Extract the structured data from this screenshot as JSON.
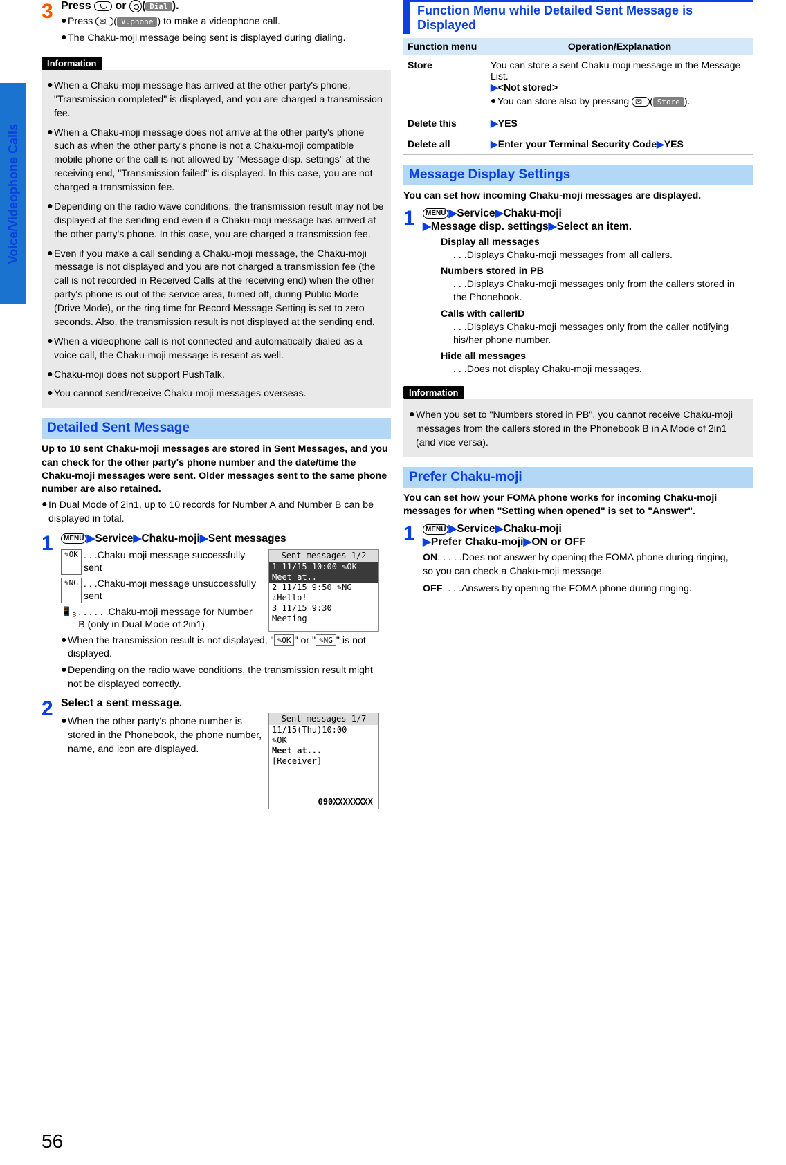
{
  "pageNumber": "56",
  "sideTab": "Voice/Videophone Calls",
  "left": {
    "step3": {
      "num": "3",
      "title_a": "Press ",
      "title_b": " or ",
      "title_c": "(",
      "softkey_dial": "Dial",
      "title_d": ").",
      "b1a": "Press ",
      "b1b": "(",
      "softkey_vphone": "V.phone",
      "b1c": ") to make a videophone call.",
      "b2": "The Chaku-moji message being sent is displayed during dialing."
    },
    "info": {
      "head": "Information",
      "items": [
        "When a Chaku-moji message has arrived at the other party's phone, \"Transmission completed\" is displayed, and you are charged a transmission fee.",
        "When a Chaku-moji message does not arrive at the other party's phone such as when the other party's phone is not a Chaku-moji compatible mobile phone or the call is not allowed by \"Message disp. settings\" at the receiving end, \"Transmission failed\" is displayed. In this case, you are not charged a transmission fee.",
        "Depending on the radio wave conditions, the transmission result may not be displayed at the sending end even if a Chaku-moji message has arrived at the other party's phone. In this case, you are charged a transmission fee.",
        "Even if you make a call sending a Chaku-moji message, the Chaku-moji message is not displayed and you are not charged a transmission fee (the call is not recorded in Received Calls at the receiving end) when the other party's phone is out of the service area, turned off, during Public Mode (Drive Mode), or the ring time for Record Message Setting is set to zero seconds. Also, the transmission result is not displayed at the sending end.",
        "When a videophone call is not connected and automatically dialed as a voice call, the Chaku-moji message is resent as well.",
        "Chaku-moji does not support PushTalk.",
        "You cannot send/receive Chaku-moji messages overseas."
      ]
    },
    "detailed": {
      "head": "Detailed Sent Message",
      "intro": "Up to 10 sent Chaku-moji messages are stored in Sent Messages, and you can check for the other party's phone number and the date/time the Chaku-moji messages were sent. Older messages sent to the same phone number are also retained.",
      "dual": "In Dual Mode of 2in1, up to 10 records for Number A and Number B can be displayed in total.",
      "step1": {
        "num": "1",
        "path_service": "Service",
        "path_chaku": "Chaku-moji",
        "path_sent": "Sent messages",
        "ok_label": "✎OK",
        "ok_desc": " . . .Chaku-moji message successfully sent",
        "ng_label": "✎NG",
        "ng_desc": " . . .Chaku-moji message unsuccessfully sent",
        "b_label": "📱B",
        "b_desc": " . . . . . .Chaku-moji message for Number B (only in Dual Mode of 2in1)",
        "note1a": "When the transmission result is not displayed, \"",
        "note1b": "\" or \"",
        "note1c": "\" is not displayed.",
        "note2": "Depending on the radio wave conditions, the transmission result might not be displayed correctly.",
        "screen": {
          "title": "Sent messages  1/2",
          "r1": "1 11/15 10:00 ✎OK",
          "r1b": "  Meet at..",
          "r2": "2 11/15 9:50  ✎NG",
          "r2b": "  ☆Hello!",
          "r3": "3 11/15 9:30",
          "r3b": "  Meeting"
        }
      },
      "step2": {
        "num": "2",
        "title": "Select a sent message.",
        "b1": "When the other party's phone number is stored in the Phonebook, the phone number, name, and icon are displayed.",
        "screen": {
          "title": "Sent messages  1/7",
          "r1": "11/15(Thu)10:00",
          "r2": "✎OK",
          "r3": "Meet at...",
          "r4": "[Receiver]",
          "r5": "090XXXXXXXX"
        }
      }
    }
  },
  "right": {
    "fmenu": {
      "head": "Function Menu while Detailed Sent Message is Displayed",
      "th1": "Function menu",
      "th2": "Operation/Explanation",
      "store": {
        "name": "Store",
        "l1": "You can store a sent Chaku-moji message in the Message List.",
        "l2": "<Not stored>",
        "l3a": "You can store also by pressing ",
        "l3b": "(",
        "softkey_store": "Store",
        "l3c": ")."
      },
      "delthis": {
        "name": "Delete this",
        "val": "YES"
      },
      "delall": {
        "name": "Delete all",
        "val_a": "Enter your Terminal Security Code",
        "val_b": "YES"
      }
    },
    "msgdisp": {
      "head": "Message Display Settings",
      "intro": "You can set how incoming Chaku-moji messages are displayed.",
      "step1": {
        "num": "1",
        "service": "Service",
        "chaku": "Chaku-moji",
        "msgdisp": "Message disp. settings",
        "selectitem": "Select an item.",
        "opts": [
          {
            "lbl": "Display all messages",
            "desc": ". . .Displays Chaku-moji messages from all callers."
          },
          {
            "lbl": "Numbers stored in PB",
            "desc": ". . .Displays Chaku-moji messages only from the callers stored in the Phonebook."
          },
          {
            "lbl": "Calls with callerID",
            "desc": ". . .Displays Chaku-moji messages only from the caller notifying his/her phone number."
          },
          {
            "lbl": "Hide all messages",
            "desc": ". . .Does not display Chaku-moji messages."
          }
        ]
      },
      "info": {
        "head": "Information",
        "item": "When you set to \"Numbers stored in PB\", you cannot receive Chaku-moji messages from the callers stored in the Phonebook B in A Mode of 2in1 (and vice versa)."
      }
    },
    "prefer": {
      "head": "Prefer Chaku-moji",
      "intro": "You can set how your FOMA phone works for incoming Chaku-moji messages for when \"Setting when opened\" is set to \"Answer\".",
      "step1": {
        "num": "1",
        "service": "Service",
        "chaku": "Chaku-moji",
        "prefer": "Prefer Chaku-moji",
        "onoff": "ON or OFF",
        "on_lbl": "ON",
        "on_desc": ". . . . .Does not answer by opening the FOMA phone during ringing, so you can check a Chaku-moji message.",
        "off_lbl": "OFF",
        "off_desc": ". . . .Answers by opening the FOMA phone during ringing."
      }
    }
  }
}
